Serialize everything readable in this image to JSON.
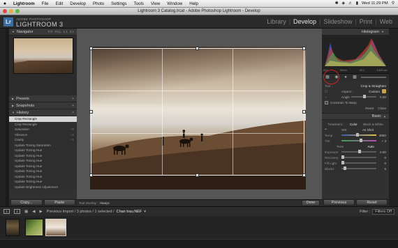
{
  "menubar": {
    "apple": "",
    "items": [
      "Lightroom",
      "File",
      "Edit",
      "Develop",
      "Photo",
      "Settings",
      "Tools",
      "View",
      "Window",
      "Help"
    ],
    "clock": "Wed 11:29 PM"
  },
  "window": {
    "title": "Lightroom 3 Catalog.lrcat - Adobe Photoshop Lightroom - Develop"
  },
  "identity": {
    "logo": "Lr",
    "brand_small": "ADOBE PHOTOSHOP",
    "brand_big": "LIGHTROOM 3"
  },
  "modules": [
    "Library",
    "Develop",
    "Slideshow",
    "Print",
    "Web"
  ],
  "active_module": "Develop",
  "left": {
    "navigator": {
      "title": "Navigator",
      "opts": [
        "FIT",
        "FILL",
        "1:1",
        "3:1"
      ]
    },
    "presets": "Presets",
    "snapshots": "Snapshots",
    "history": {
      "title": "History",
      "items": [
        {
          "label": "Crop Rectangle",
          "value": ""
        },
        {
          "label": "Crop Rectangle",
          "value": ""
        },
        {
          "label": "Saturation",
          "value": "+2"
        },
        {
          "label": "Vibrance",
          "value": "+2"
        },
        {
          "label": "Clarity",
          "value": "+1"
        },
        {
          "label": "Update Toning Saturation",
          "value": ""
        },
        {
          "label": "Update Toning Hue",
          "value": ""
        },
        {
          "label": "Update Toning Hue",
          "value": ""
        },
        {
          "label": "Update Toning Hue",
          "value": ""
        },
        {
          "label": "Update Toning Hue",
          "value": ""
        },
        {
          "label": "Update Toning Hue",
          "value": ""
        },
        {
          "label": "Update Toning Hue",
          "value": ""
        },
        {
          "label": "Update Toning Hue",
          "value": ""
        },
        {
          "label": "Update Brightness Adjustment",
          "value": ""
        }
      ]
    },
    "copy_label": "Copy...",
    "paste_label": "Paste"
  },
  "toolbar": {
    "overlay_label": "Tool Overlay :",
    "overlay_value": "Always",
    "done_label": "Done"
  },
  "right": {
    "histogram_title": "Histogram",
    "hist_info": [
      "ISO",
      "50mm",
      "f/8.0",
      "1/400 sec"
    ],
    "crop_label": "Crop & Straighten",
    "tool": "Tool :",
    "aspect_label": "Aspect :",
    "aspect_value": "Custom",
    "angle_label": "Angle",
    "angle_value": "0.00",
    "constrain_label": "Constrain To Warp",
    "reset_label": "Reset",
    "close_label": "Close",
    "basic_title": "Basic",
    "treatment_label": "Treatment :",
    "color_label": "Color",
    "bw_label": "Black & White",
    "wb_label": "WB :",
    "wb_value": "As Shot",
    "temp_label": "Temp",
    "temp_value": "4650",
    "tint_label": "Tint",
    "tint_value": "+ 3",
    "tone_label": "Tone",
    "auto_label": "Auto",
    "exposure_label": "Exposure",
    "exposure_value": "0.00",
    "recovery_label": "Recovery",
    "recovery_value": "0",
    "filllight_label": "Fill Light",
    "filllight_value": "0",
    "blacks_label": "Blacks",
    "blacks_value": "5",
    "previous_label": "Previous",
    "reset_btn_label": "Reset"
  },
  "filmstrip": {
    "pages": [
      "1",
      "2"
    ],
    "source": "Previous Import / 3 photos / 1 selected /",
    "file": "Chan trau.NEF",
    "filter_label": "Filter :",
    "filter_value": "Filters Off"
  }
}
